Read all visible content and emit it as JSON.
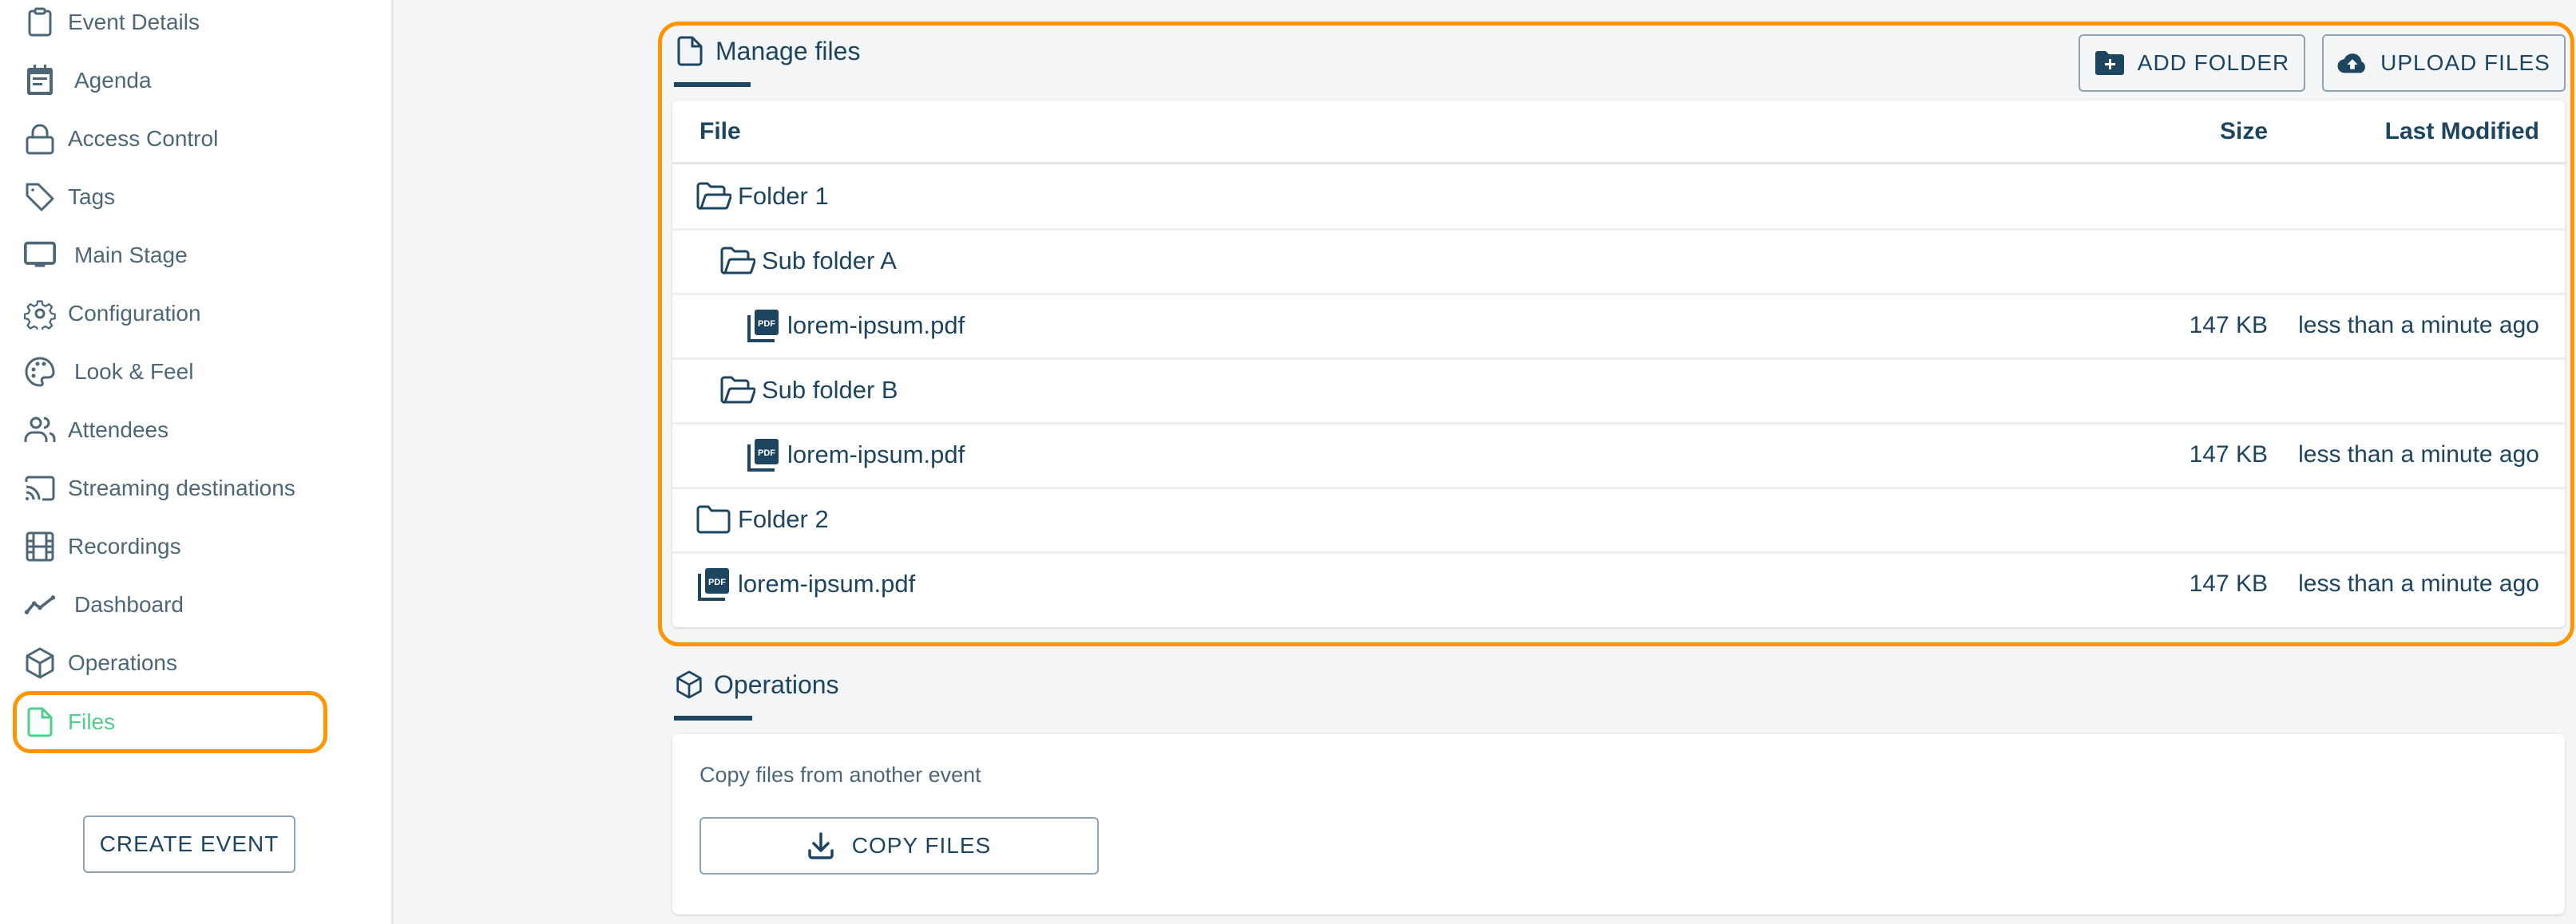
{
  "sidebar": {
    "items": [
      {
        "label": "Event Details",
        "icon": "clipboard-icon"
      },
      {
        "label": "Agenda",
        "icon": "calendar-icon"
      },
      {
        "label": "Access Control",
        "icon": "lock-icon"
      },
      {
        "label": "Tags",
        "icon": "tag-icon"
      },
      {
        "label": "Main Stage",
        "icon": "monitor-icon"
      },
      {
        "label": "Configuration",
        "icon": "gear-icon"
      },
      {
        "label": "Look & Feel",
        "icon": "palette-icon"
      },
      {
        "label": "Attendees",
        "icon": "users-icon"
      },
      {
        "label": "Streaming destinations",
        "icon": "cast-icon"
      },
      {
        "label": "Recordings",
        "icon": "film-icon"
      },
      {
        "label": "Dashboard",
        "icon": "chart-line-icon"
      },
      {
        "label": "Operations",
        "icon": "cube-icon"
      },
      {
        "label": "Files",
        "icon": "file-icon",
        "active": true
      }
    ],
    "create_event_label": "CREATE EVENT"
  },
  "colors": {
    "accent": "#1d4560",
    "active": "#4fd08a",
    "highlight": "#ff9500",
    "muted": "#4d6777",
    "background": "#f3f5f7"
  },
  "files_section": {
    "title": "Manage files",
    "icon": "file-icon",
    "add_folder_label": "ADD FOLDER",
    "upload_files_label": "UPLOAD FILES",
    "columns": {
      "file": "File",
      "size": "Size",
      "modified": "Last Modified"
    },
    "rows": [
      {
        "name": "Folder 1",
        "type": "folder-open",
        "depth": 0,
        "size": "",
        "modified": ""
      },
      {
        "name": "Sub folder A",
        "type": "folder-open",
        "depth": 1,
        "size": "",
        "modified": ""
      },
      {
        "name": "lorem-ipsum.pdf",
        "type": "pdf",
        "depth": 2,
        "size": "147 KB",
        "modified": "less than a minute ago"
      },
      {
        "name": "Sub folder B",
        "type": "folder-open",
        "depth": 1,
        "size": "",
        "modified": ""
      },
      {
        "name": "lorem-ipsum.pdf",
        "type": "pdf",
        "depth": 2,
        "size": "147 KB",
        "modified": "less than a minute ago"
      },
      {
        "name": "Folder 2",
        "type": "folder",
        "depth": 0,
        "size": "",
        "modified": ""
      },
      {
        "name": "lorem-ipsum.pdf",
        "type": "pdf",
        "depth": 0,
        "size": "147 KB",
        "modified": "less than a minute ago"
      }
    ]
  },
  "operations_section": {
    "title": "Operations",
    "icon": "cube-icon",
    "description": "Copy files from another event",
    "copy_files_label": "COPY FILES"
  }
}
